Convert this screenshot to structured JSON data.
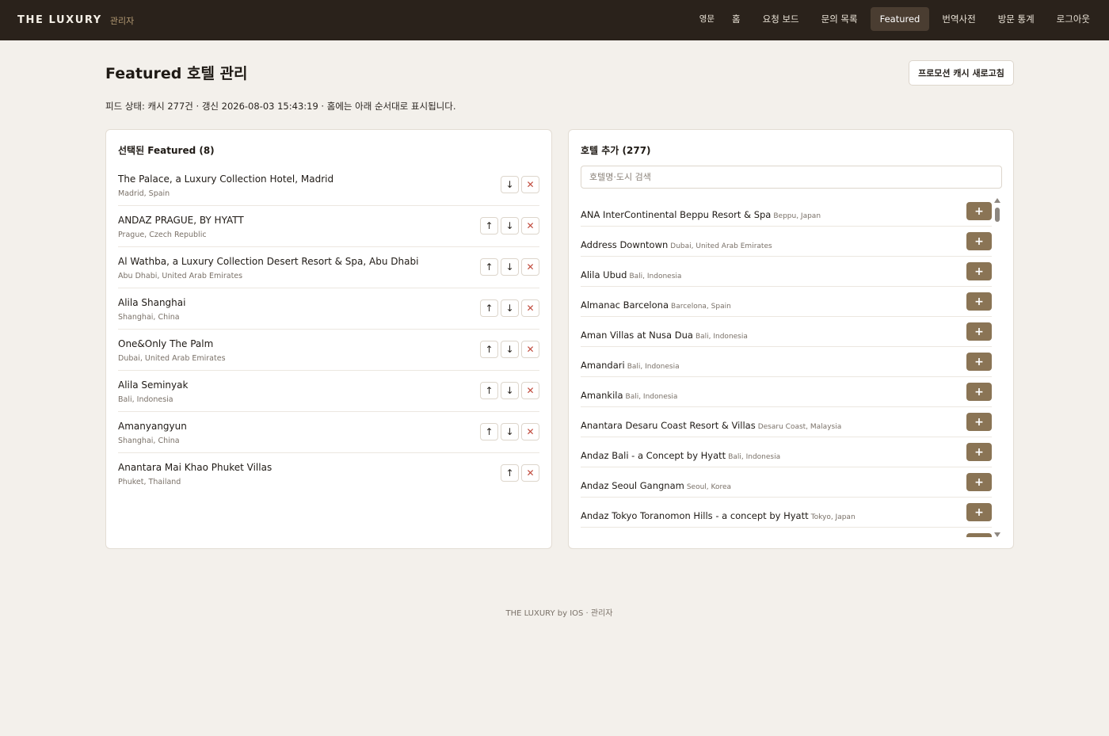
{
  "brand": {
    "name": "THE LUXURY",
    "sub": "관리자"
  },
  "nav": [
    {
      "label": "영문",
      "small": true
    },
    {
      "label": "홈"
    },
    {
      "label": "요청 보드"
    },
    {
      "label": "문의 목록"
    },
    {
      "label": "Featured",
      "active": true
    },
    {
      "label": "번역사전"
    },
    {
      "label": "방문 통계"
    },
    {
      "label": "로그아웃"
    }
  ],
  "page": {
    "title": "Featured 호텔 관리",
    "refresh_label": "프로모션 캐시 새로고침",
    "status": "피드 상태: 캐시 277건 · 갱신 2026-08-03 15:43:19 · 홈에는 아래 순서대로 표시됩니다."
  },
  "selected": {
    "title": "선택된 Featured (8)",
    "items": [
      {
        "name": "The Palace, a Luxury Collection Hotel, Madrid",
        "location": "Madrid, Spain"
      },
      {
        "name": "ANDAZ PRAGUE, BY HYATT",
        "location": "Prague, Czech Republic"
      },
      {
        "name": "Al Wathba, a Luxury Collection Desert Resort & Spa, Abu Dhabi",
        "location": "Abu Dhabi, United Arab Emirates"
      },
      {
        "name": "Alila Shanghai",
        "location": "Shanghai, China"
      },
      {
        "name": "One&Only The Palm",
        "location": "Dubai, United Arab Emirates"
      },
      {
        "name": "Alila Seminyak",
        "location": "Bali, Indonesia"
      },
      {
        "name": "Amanyangyun",
        "location": "Shanghai, China"
      },
      {
        "name": "Anantara Mai Khao Phuket Villas",
        "location": "Phuket, Thailand"
      }
    ]
  },
  "add": {
    "title": "호텔 추가 (277)",
    "search_placeholder": "호텔명·도시 검색",
    "items": [
      {
        "name": "ANA InterContinental Beppu Resort & Spa",
        "location": "Beppu, Japan"
      },
      {
        "name": "Address Downtown",
        "location": "Dubai, United Arab Emirates"
      },
      {
        "name": "Alila Ubud",
        "location": "Bali, Indonesia"
      },
      {
        "name": "Almanac Barcelona",
        "location": "Barcelona, Spain"
      },
      {
        "name": "Aman Villas at Nusa Dua",
        "location": "Bali, Indonesia"
      },
      {
        "name": "Amandari",
        "location": "Bali, Indonesia"
      },
      {
        "name": "Amankila",
        "location": "Bali, Indonesia"
      },
      {
        "name": "Anantara Desaru Coast Resort & Villas",
        "location": "Desaru Coast, Malaysia"
      },
      {
        "name": "Andaz Bali - a Concept by Hyatt",
        "location": "Bali, Indonesia"
      },
      {
        "name": "Andaz Seoul Gangnam",
        "location": "Seoul, Korea"
      },
      {
        "name": "Andaz Tokyo Toranomon Hills - a concept by Hyatt",
        "location": "Tokyo, Japan"
      }
    ]
  },
  "icons": {
    "up": "↑",
    "down": "↓",
    "remove": "✕",
    "add": "+"
  },
  "footer": "THE LUXURY by IOS · 관리자",
  "colors": {
    "topbar": "#2a221b",
    "accent": "#8a7455",
    "remove": "#c04a3c",
    "background": "#f3f0eb"
  }
}
